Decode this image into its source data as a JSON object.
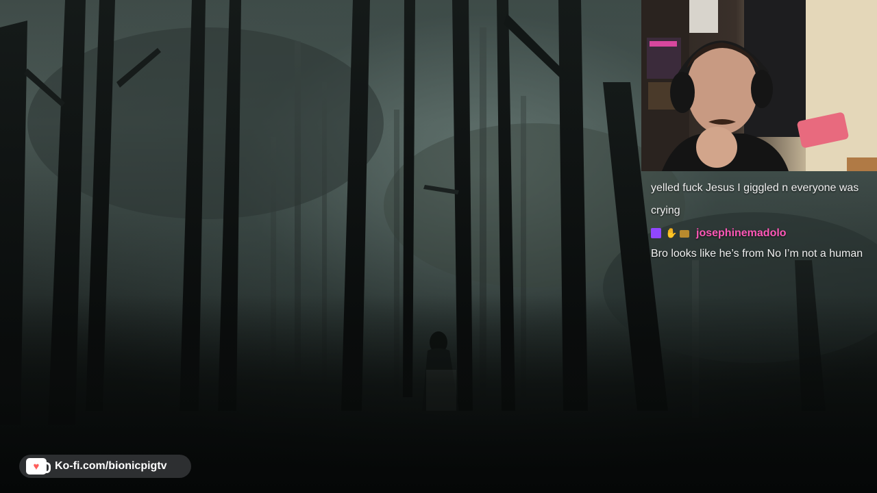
{
  "stream": {
    "background_scene": "foggy-forest-with-hooded-figure"
  },
  "webcam": {
    "icon": "webcam-feed"
  },
  "chat": {
    "messages": [
      {
        "text": "yelled fuck Jesus I giggled n everyone was crying"
      },
      {
        "badges": [
          "sub-badge-icon",
          "hand-badge-icon",
          "gift-badge-icon"
        ],
        "username": "josephinemadolo",
        "text": "Bro looks like he’s from No I’m not a human"
      }
    ],
    "username_color": "#ff58b8"
  },
  "kofi": {
    "label": "Ko-fi.com/bionicpigtv",
    "icon": "kofi-cup-icon",
    "accent": "#ff5e5b"
  }
}
